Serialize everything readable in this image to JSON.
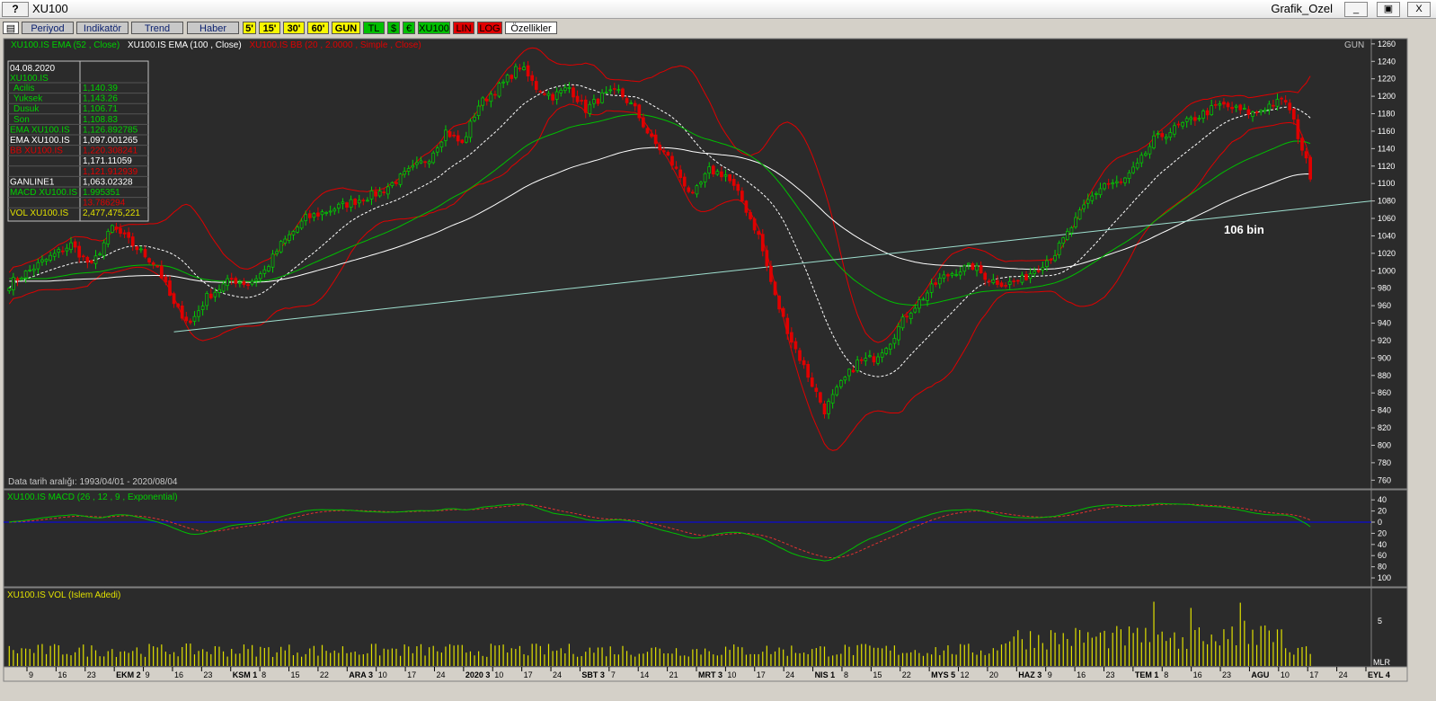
{
  "window": {
    "help": "?",
    "title": "XU100",
    "name": "Grafik_Ozel",
    "minimize": "_",
    "restore": "▣",
    "close": "X"
  },
  "toolbar": {
    "items": [
      "Periyod",
      "Indikatör",
      "Trend",
      "Haber",
      "5'",
      "15'",
      "30'",
      "60'",
      "GUN",
      "TL",
      "$",
      "€",
      "XU100",
      "LIN",
      "LOG",
      "Özellikler"
    ]
  },
  "main_panel": {
    "legend": [
      "XU100.IS EMA (52 , Close)",
      "XU100.IS EMA (100 , Close)",
      "XU100.IS BB (20 , 2.0000 , Simple , Close)"
    ],
    "period": "GUN",
    "annotation": "106 bin",
    "date_range": "Data tarih aralığı: 1993/04/01 - 2020/08/04"
  },
  "info_box": {
    "date": "04.08.2020",
    "symbol": "XU100.IS",
    "rows": [
      {
        "label": "Acilis",
        "value": "1,140.39"
      },
      {
        "label": "Yuksek",
        "value": "1,143.26"
      },
      {
        "label": "Dusuk",
        "value": "1,106.71"
      },
      {
        "label": "Son",
        "value": "1,108.83"
      },
      {
        "label": "EMA XU100.IS",
        "value": "1,126.892785"
      },
      {
        "label": "EMA XU100.IS",
        "value": "1,097.001265"
      },
      {
        "label": "BB XU100.IS",
        "value": "1,220.308241"
      },
      {
        "label": "",
        "value": "1,171.11059"
      },
      {
        "label": "",
        "value": "1,121.912939"
      },
      {
        "label": "GANLINE1",
        "value": "1,063.02328"
      },
      {
        "label": "MACD XU100.IS",
        "value": "1.995351"
      },
      {
        "label": "",
        "value": "13.786294"
      },
      {
        "label": "VOL XU100.IS",
        "value": "2,477,475,221"
      }
    ]
  },
  "macd_panel": {
    "legend": "XU100.IS MACD (26 , 12 , 9 , Exponential)"
  },
  "vol_panel": {
    "legend": "XU100.IS VOL (Islem Adedi)",
    "scale_label": "5",
    "corner": "MLR"
  },
  "colors": {
    "background": "#2b2b2b",
    "candle_up": "#00d000",
    "candle_down": "#e00000",
    "ema52": "#00c000",
    "ema100": "#ffffff",
    "bollinger": "#e00000",
    "trend_line": "#9fe0d0",
    "volume": "#e0e000",
    "macd_line": "#00c000",
    "signal_line": "#e03030",
    "zero_line": "#0000ff"
  },
  "chart_data": [
    {
      "type": "candlestick",
      "yticks": [
        760,
        780,
        800,
        820,
        840,
        860,
        880,
        900,
        920,
        940,
        960,
        980,
        1000,
        1020,
        1040,
        1060,
        1080,
        1100,
        1120,
        1140,
        1160,
        1180,
        1200,
        1220,
        1240,
        1260
      ],
      "ylim": [
        750,
        1265
      ],
      "anchors": [
        [
          0,
          985
        ],
        [
          8,
          1010
        ],
        [
          15,
          1030
        ],
        [
          20,
          1005
        ],
        [
          25,
          1050
        ],
        [
          30,
          1030
        ],
        [
          36,
          1005
        ],
        [
          40,
          960
        ],
        [
          44,
          940
        ],
        [
          48,
          970
        ],
        [
          54,
          990
        ],
        [
          58,
          985
        ],
        [
          62,
          1000
        ],
        [
          66,
          1030
        ],
        [
          72,
          1060
        ],
        [
          78,
          1070
        ],
        [
          84,
          1080
        ],
        [
          90,
          1090
        ],
        [
          96,
          1110
        ],
        [
          102,
          1130
        ],
        [
          106,
          1160
        ],
        [
          110,
          1145
        ],
        [
          114,
          1190
        ],
        [
          120,
          1215
        ],
        [
          124,
          1235
        ],
        [
          128,
          1210
        ],
        [
          132,
          1200
        ],
        [
          136,
          1210
        ],
        [
          140,
          1185
        ],
        [
          144,
          1200
        ],
        [
          148,
          1205
        ],
        [
          152,
          1185
        ],
        [
          156,
          1150
        ],
        [
          160,
          1130
        ],
        [
          164,
          1100
        ],
        [
          166,
          1085
        ],
        [
          170,
          1115
        ],
        [
          174,
          1110
        ],
        [
          178,
          1080
        ],
        [
          182,
          1040
        ],
        [
          186,
          970
        ],
        [
          190,
          920
        ],
        [
          194,
          880
        ],
        [
          198,
          840
        ],
        [
          202,
          870
        ],
        [
          206,
          895
        ],
        [
          210,
          900
        ],
        [
          214,
          920
        ],
        [
          218,
          950
        ],
        [
          222,
          970
        ],
        [
          226,
          990
        ],
        [
          230,
          1000
        ],
        [
          234,
          1005
        ],
        [
          238,
          990
        ],
        [
          242,
          985
        ],
        [
          246,
          990
        ],
        [
          250,
          1005
        ],
        [
          254,
          1020
        ],
        [
          258,
          1050
        ],
        [
          262,
          1080
        ],
        [
          266,
          1100
        ],
        [
          270,
          1100
        ],
        [
          274,
          1120
        ],
        [
          278,
          1150
        ],
        [
          282,
          1160
        ],
        [
          286,
          1170
        ],
        [
          290,
          1180
        ],
        [
          294,
          1190
        ],
        [
          298,
          1185
        ],
        [
          302,
          1180
        ],
        [
          306,
          1190
        ],
        [
          310,
          1195
        ],
        [
          312,
          1170
        ],
        [
          314,
          1140
        ],
        [
          316,
          1110
        ]
      ],
      "series": [
        "EMA (52)",
        "EMA (100)",
        "BB (20)"
      ],
      "annotations": [
        "106 bin"
      ]
    },
    {
      "type": "line",
      "yticks": [
        40,
        20,
        0,
        -20,
        -40,
        -60,
        -80,
        -100
      ],
      "tick_labels": [
        "40",
        "20",
        "0",
        "20",
        "40",
        "60",
        "80",
        "100"
      ],
      "ylim": [
        -108,
        50
      ],
      "series": [
        "MACD",
        "Signal"
      ]
    },
    {
      "type": "bar",
      "ytick_label": "5",
      "series": [
        "VOL"
      ]
    },
    {
      "type": "x-axis",
      "labels": [
        {
          "day": 9,
          "month": ""
        },
        {
          "day": 16,
          "month": ""
        },
        {
          "day": 23,
          "month": ""
        },
        {
          "day": 2,
          "month": "EKM"
        },
        {
          "day": 9,
          "month": ""
        },
        {
          "day": 16,
          "month": ""
        },
        {
          "day": 23,
          "month": ""
        },
        {
          "day": 1,
          "month": "KSM"
        },
        {
          "day": 8,
          "month": ""
        },
        {
          "day": 15,
          "month": ""
        },
        {
          "day": 22,
          "month": ""
        },
        {
          "day": 3,
          "month": "ARA"
        },
        {
          "day": 10,
          "month": ""
        },
        {
          "day": 17,
          "month": ""
        },
        {
          "day": 24,
          "month": ""
        },
        {
          "day": 3,
          "month": "2020"
        },
        {
          "day": 10,
          "month": ""
        },
        {
          "day": 17,
          "month": ""
        },
        {
          "day": 24,
          "month": ""
        },
        {
          "day": 3,
          "month": "SBT"
        },
        {
          "day": 7,
          "month": ""
        },
        {
          "day": 14,
          "month": ""
        },
        {
          "day": 21,
          "month": ""
        },
        {
          "day": 3,
          "month": "MRT"
        },
        {
          "day": 10,
          "month": ""
        },
        {
          "day": 17,
          "month": ""
        },
        {
          "day": 24,
          "month": ""
        },
        {
          "day": 1,
          "month": "NIS"
        },
        {
          "day": 8,
          "month": ""
        },
        {
          "day": 15,
          "month": ""
        },
        {
          "day": 22,
          "month": ""
        },
        {
          "day": 5,
          "month": "MYS"
        },
        {
          "day": 12,
          "month": ""
        },
        {
          "day": 20,
          "month": ""
        },
        {
          "day": 3,
          "month": "HAZ"
        },
        {
          "day": 9,
          "month": ""
        },
        {
          "day": 16,
          "month": ""
        },
        {
          "day": 23,
          "month": ""
        },
        {
          "day": 1,
          "month": "TEM"
        },
        {
          "day": 8,
          "month": ""
        },
        {
          "day": 16,
          "month": ""
        },
        {
          "day": 23,
          "month": ""
        },
        {
          "day": "",
          "month": "AGU"
        },
        {
          "day": 10,
          "month": ""
        },
        {
          "day": 17,
          "month": ""
        },
        {
          "day": 24,
          "month": ""
        },
        {
          "day": 4,
          "month": "EYL"
        }
      ]
    }
  ]
}
